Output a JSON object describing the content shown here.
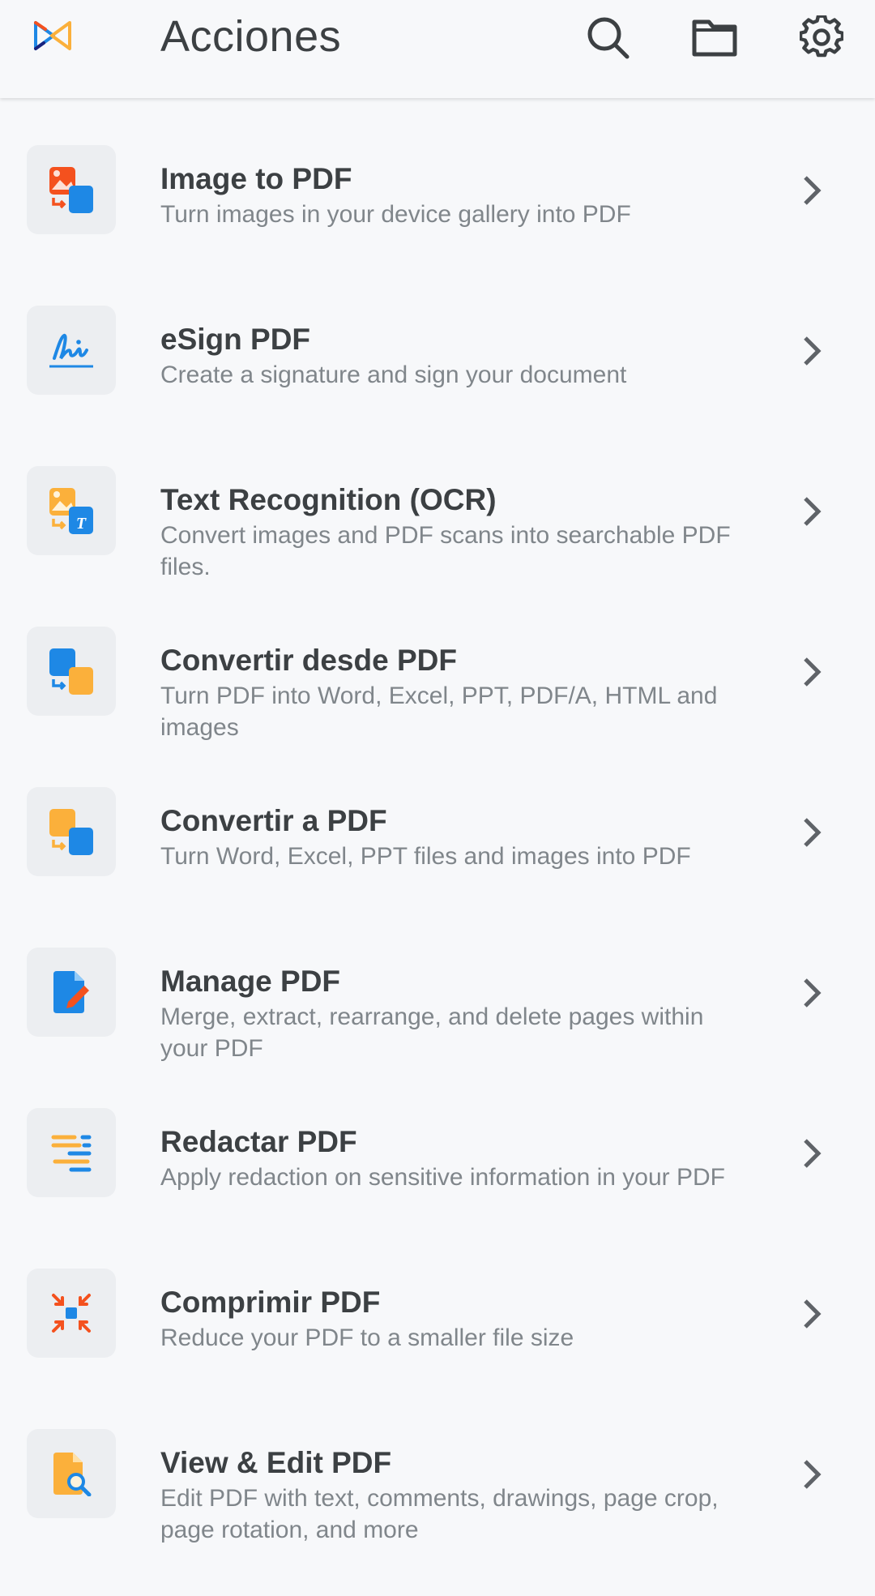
{
  "header": {
    "title": "Acciones",
    "icons": [
      "app-logo-icon",
      "search-icon",
      "folder-icon",
      "gear-icon"
    ]
  },
  "colors": {
    "background": "#f7f8fa",
    "tile": "#eceef1",
    "title_text": "#3c4043",
    "description_text": "#80868b",
    "blue": "#1e88e5",
    "orange_red": "#f4511e",
    "amber": "#fbb03b"
  },
  "actions": [
    {
      "name": "Image to PDF",
      "description": "Turn images in your device gallery into PDF",
      "icon": "image-to-pdf-icon"
    },
    {
      "name": "eSign PDF",
      "description": "Create a signature and sign your document",
      "icon": "signature-icon"
    },
    {
      "name": "Text Recognition (OCR)",
      "description": "Convert images and PDF scans into searchable PDF files.",
      "icon": "ocr-icon"
    },
    {
      "name": "Convertir desde PDF",
      "description": "Turn PDF into Word, Excel, PPT, PDF/A, HTML and images",
      "icon": "convert-from-pdf-icon"
    },
    {
      "name": "Convertir a PDF",
      "description": "Turn Word, Excel, PPT files and images into PDF",
      "icon": "convert-to-pdf-icon"
    },
    {
      "name": "Manage PDF",
      "description": "Merge, extract, rearrange, and delete pages within your PDF",
      "icon": "manage-pdf-icon"
    },
    {
      "name": "Redactar PDF",
      "description": "Apply redaction on sensitive information in your PDF",
      "icon": "redact-icon"
    },
    {
      "name": "Comprimir PDF",
      "description": "Reduce your PDF to a smaller file size",
      "icon": "compress-icon"
    },
    {
      "name": "View & Edit PDF",
      "description": "Edit PDF with text, comments, drawings, page crop, page rotation, and more",
      "icon": "view-edit-icon"
    }
  ]
}
